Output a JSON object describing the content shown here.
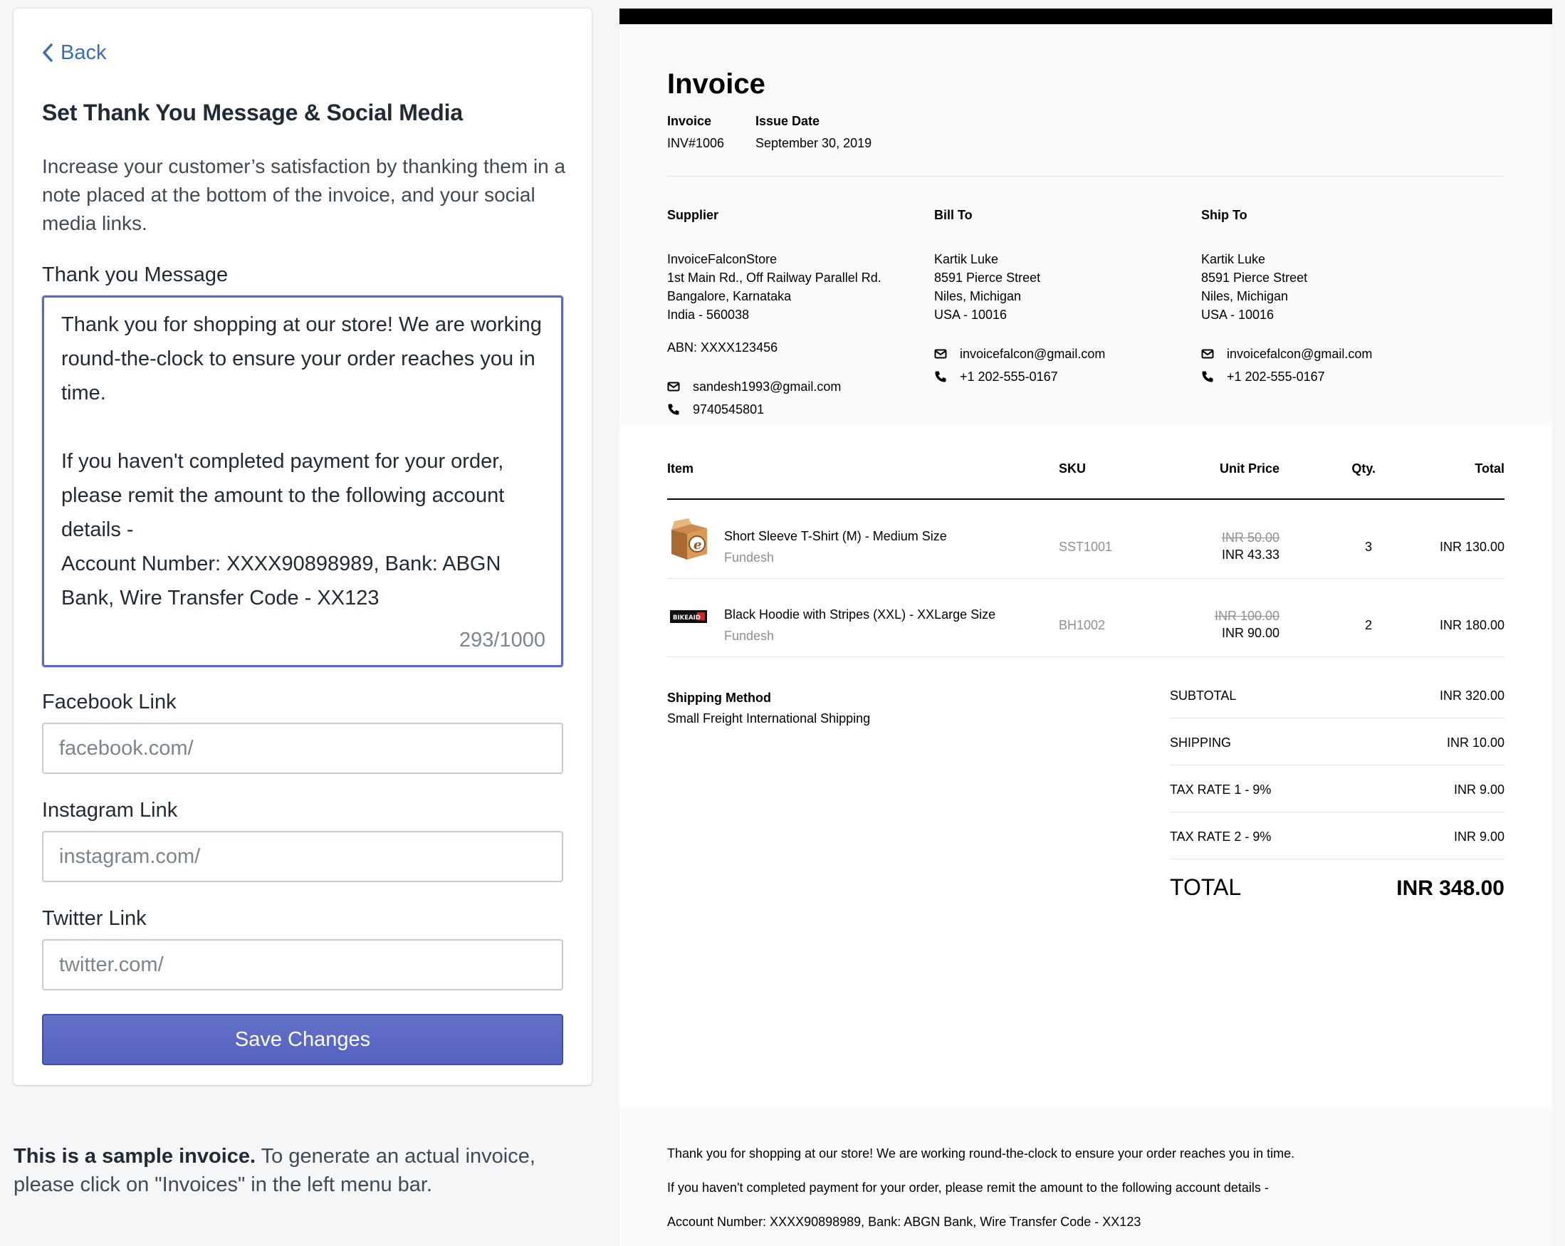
{
  "settings": {
    "back_label": "Back",
    "title": "Set Thank You Message & Social Media",
    "description": "Increase your customer’s satisfaction by thanking them in a note placed at the bottom of the invoice, and your social media links.",
    "thank_you": {
      "label": "Thank you Message",
      "value": "Thank you for shopping at our store! We are working round-the-clock to ensure your order reaches you in time.\n\nIf you haven't completed payment for your order, please remit the amount to the following account details -\nAccount Number: XXXX90898989, Bank: ABGN Bank, Wire Transfer Code - XX123",
      "counter": "293/1000"
    },
    "facebook": {
      "label": "Facebook Link",
      "placeholder": "facebook.com/"
    },
    "instagram": {
      "label": "Instagram Link",
      "placeholder": "instagram.com/"
    },
    "twitter": {
      "label": "Twitter Link",
      "placeholder": "twitter.com/"
    },
    "save_label": "Save Changes"
  },
  "sample_note": {
    "bold": "This is a sample invoice.",
    "rest": " To generate an actual invoice, please click on \"Invoices\" in the left menu bar."
  },
  "invoice": {
    "title": "Invoice",
    "number_label": "Invoice",
    "number": "INV#1006",
    "date_label": "Issue Date",
    "date": "September 30, 2019",
    "supplier": {
      "label": "Supplier",
      "lines": [
        "InvoiceFalconStore",
        "1st Main Rd., Off Railway Parallel Rd.",
        "Bangalore, Karnataka",
        "India - 560038"
      ],
      "abn": "ABN: XXXX123456",
      "email": "sandesh1993@gmail.com",
      "phone": "9740545801"
    },
    "bill_to": {
      "label": "Bill To",
      "lines": [
        "Kartik Luke",
        "8591 Pierce Street",
        "Niles, Michigan",
        "USA - 10016"
      ],
      "email": "invoicefalcon@gmail.com",
      "phone": "+1 202-555-0167"
    },
    "ship_to": {
      "label": "Ship To",
      "lines": [
        "Kartik Luke",
        "8591 Pierce Street",
        "Niles, Michigan",
        "USA - 10016"
      ],
      "email": "invoicefalcon@gmail.com",
      "phone": "+1 202-555-0167"
    },
    "columns": {
      "item": "Item",
      "sku": "SKU",
      "unit_price": "Unit Price",
      "qty": "Qty.",
      "total": "Total"
    },
    "items": [
      {
        "name": "Short Sleeve T-Shirt (M) - Medium Size",
        "vendor": "Fundesh",
        "sku": "SST1001",
        "old_price": "INR 50.00",
        "price": "INR 43.33",
        "qty": "3",
        "total": "INR 130.00"
      },
      {
        "name": "Black Hoodie with Stripes (XXL) - XXLarge Size",
        "vendor": "Fundesh",
        "sku": "BH1002",
        "old_price": "INR 100.00",
        "price": "INR 90.00",
        "qty": "2",
        "total": "INR 180.00",
        "logo_text": "BIKEAID"
      }
    ],
    "shipping_method_label": "Shipping Method",
    "shipping_method": "Small Freight International Shipping",
    "summary": [
      {
        "label": "SUBTOTAL",
        "value": "INR 320.00"
      },
      {
        "label": "SHIPPING",
        "value": "INR 10.00"
      },
      {
        "label": "TAX RATE 1 - 9%",
        "value": "INR 9.00"
      },
      {
        "label": "TAX RATE 2 - 9%",
        "value": "INR 9.00"
      }
    ],
    "total_label": "TOTAL",
    "total_value": "INR 348.00",
    "footer": [
      "Thank you for shopping at our store! We are working round-the-clock to ensure your order reaches you in time.",
      "If you haven't completed payment for your order, please remit the amount to the following account details -",
      "Account Number: XXXX90898989, Bank: ABGN Bank, Wire Transfer Code - XX123"
    ]
  },
  "colors": {
    "accent": "#5c6ac4",
    "link": "#3a6cb8",
    "page_bg": "#f4f6f8"
  }
}
